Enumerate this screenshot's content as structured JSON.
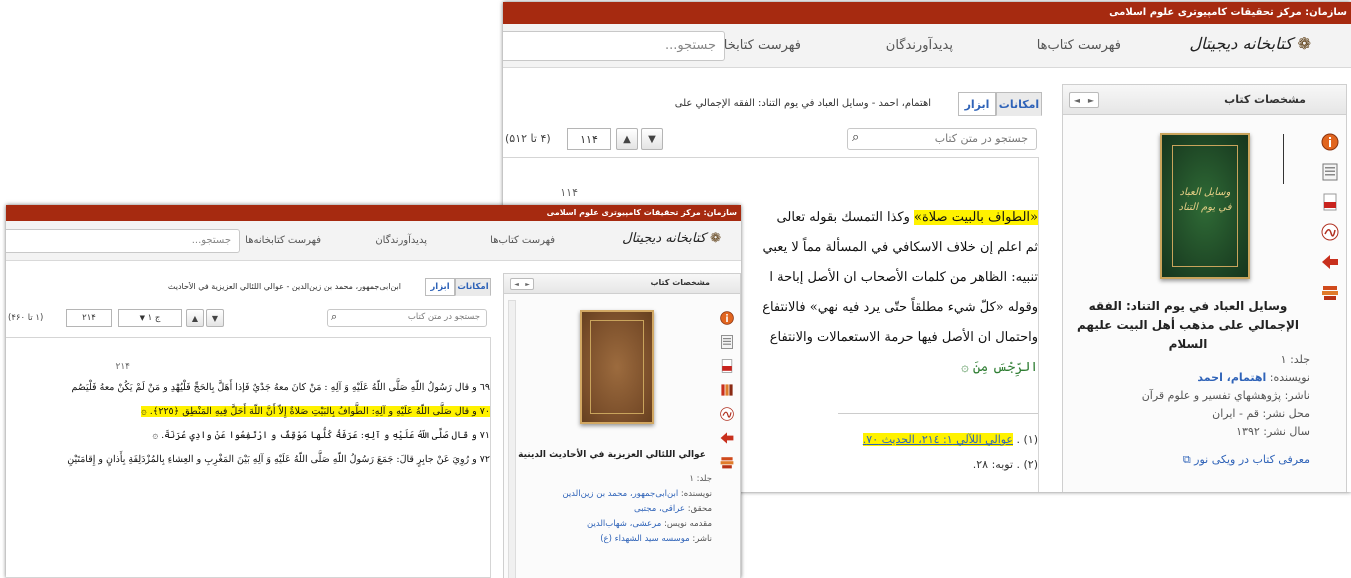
{
  "common": {
    "org_bar": "سازمان: مرکز تحقیقات کامپیوتری علوم اسلامی",
    "logo_text": "کتابخانه دیجیتال",
    "nav_books": "فهرست کتاب‌ها",
    "nav_creators": "پدیدآورندگان",
    "nav_libraries": "فهرست کتابخانه‌ها",
    "search_placeholder": "جستجو...",
    "panel_title": "مشخصات کتاب",
    "tab_capabilities": "امکانات",
    "tab_tools": "ابزار",
    "in_book_search": "جستجو در متن کتاب",
    "pager_prev": "◄",
    "pager_next": "►"
  },
  "back_window": {
    "breadcrumb": "اهتمام، احمد - وسایل العباد في يوم التناد: الفقه الإجمالي على",
    "page_input": "۱۱۴",
    "page_range": "(۴ تا ۵۱۲)",
    "page_number": "۱۱۴",
    "cover_title": "وسایل العباد في يوم التناد",
    "book_title": "وسایل العباد في يوم التناد: الفقه الإجمالي على مذهب أهل البيت عليهم السلام",
    "meta": {
      "volume": "جلد: ۱",
      "author_label": "نویسنده: ",
      "author": "اهتمام، احمد",
      "publisher": "ناشر: پژوهشهاي تفسير و علوم قرآن",
      "place": "محل نشر: قم - ایران",
      "year": "سال نشر: ۱۳۹۲",
      "wiki": "معرفی کتاب در ویکی نور"
    },
    "lines": [
      {
        "hl": "«الطواف بالبيت صلاة»",
        "rest": " وكذا التمسك بقوله تعالى"
      },
      {
        "hl": "",
        "rest": "ثم اعلم إن خلاف الاسكافي في المسألة مماً لا يعبي"
      },
      {
        "hl": "",
        "rest": "تنبيه: الظاهر من كلمات الأصحاب ان الأصل إباحة ا"
      },
      {
        "hl": "",
        "rest": "وقوله «كلّ شيء مطلقاً حتّى يرد فيه نهي» فالانتفاع"
      },
      {
        "hl": "",
        "rest": "واحتمال ان الأصل فيها حرمة الاستعمالات والانتفاع"
      },
      {
        "hl": "",
        "rest": "الرِّجْسَ مِنَ ۞"
      }
    ],
    "footnotes": [
      {
        "num": "(۱) . ",
        "link": "عوالي اللآلي ١: ٢١٤، الحديث ٧٠."
      },
      {
        "num": "(۲) . ",
        "link": "",
        "text": "توبه: ٢٨."
      }
    ]
  },
  "front_window": {
    "breadcrumb": "ابن‌ابی‌جمهور، محمد بن زین‌الدین - عوالي اللئالي العزيزية في الأحاديث",
    "chapter_select": "ج ۱",
    "page_input": "۲۱۴",
    "page_range": "(۱ تا ۴۶۰)",
    "page_number": "۲۱۴",
    "book_title": "عوالي اللئالي العزيزية في الأحاديث الدينية",
    "meta": {
      "volume": "جلد: ۱",
      "author_label": "نویسنده: ",
      "author": "ابن‌ابی‌جمهور، محمد بن زین‌الدین",
      "editor_label": "محقق: ",
      "editor": "عراقی، مجتبی",
      "intro_label": "مقدمه نویس: ",
      "intro": "مرعشی، شهاب‌الدین",
      "publisher_label": "ناشر: ",
      "publisher": "موسسه سید الشهداء (ع)"
    },
    "lines": [
      {
        "hl": "",
        "rest": "٦٩ و قال رَسُولُ اللّهِ صَلَّى اللّهُ عَلَيْهِ وَ آلِهِ : مَنْ كانَ معهُ جَدْيٌ فَإذا أَهَلَّ بِالحَجِّ فَلْيُهْدِ و مَنْ لَمْ يَكُنْ معهُ فَلْيَصُم"
      },
      {
        "hl": "٧٠ و قال صَلَّى اللّهُ عَلَيْهِ و آلِهِ: الطَّوافُ بِالبَيْتِ صَلاةٌ إِلاّ أَنَّ اللّهَ أَحَلَّ فِيهِ المَنْطِق ﴿٢٢٥﴾. ۞",
        "rest": ""
      },
      {
        "hl": "",
        "rest": "٧١ و قال صَلَّى اللّهُ عَلَيْهِ و آلِهِ: عَرَفَةُ كُلُّها مَوْقِفٌ و ارْتَفِعُوا عَنْ وادِي عُرَنَةَ. ۞"
      },
      {
        "hl": "",
        "rest": "٧٢ و رُوِيَ عَنْ جابِرٍ قالَ: جَمَعَ رَسُولُ اللّهِ صَلَّى اللّهُ عَلَيْهِ وَ آلِهِ بَيْنَ المَغْرِبِ و العِشاءِ بِالمُزْدَلِفَةِ بِأَذانٍ و إِقامَتَيْنِ"
      }
    ]
  }
}
